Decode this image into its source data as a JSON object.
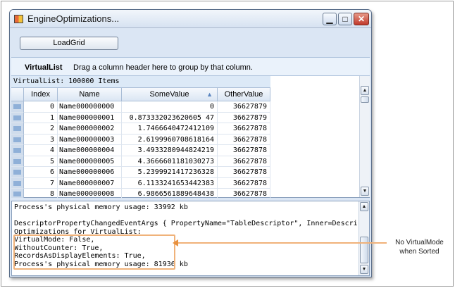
{
  "window": {
    "title": "EngineOptimizations...",
    "controls": {
      "minimize": "▁",
      "maximize": "□",
      "close": "✕"
    }
  },
  "toolbar": {
    "load_grid_label": "LoadGrid"
  },
  "group_bar": {
    "table_name": "VirtualList",
    "hint": "Drag a column header here to group by that column."
  },
  "grid": {
    "caption": "VirtualList: 100000 Items",
    "columns": [
      "Index",
      "Name",
      "SomeValue",
      "OtherValue"
    ],
    "sorted_column": "SomeValue",
    "sort_direction": "ascending",
    "rows": [
      {
        "index": "0",
        "name": "Name000000000",
        "some_value": "0",
        "other_value": "36627879"
      },
      {
        "index": "1",
        "name": "Name000000001",
        "some_value": "0.873332023620605 47",
        "other_value": "36627879"
      },
      {
        "index": "2",
        "name": "Name000000002",
        "some_value": "1.7466640472412109",
        "other_value": "36627878"
      },
      {
        "index": "3",
        "name": "Name000000003",
        "some_value": "2.6199960708618164",
        "other_value": "36627878"
      },
      {
        "index": "4",
        "name": "Name000000004",
        "some_value": "3.4933280944824219",
        "other_value": "36627878"
      },
      {
        "index": "5",
        "name": "Name000000005",
        "some_value": "4.3666601181030273",
        "other_value": "36627878"
      },
      {
        "index": "6",
        "name": "Name000000006",
        "some_value": "5.2399921417236328",
        "other_value": "36627878"
      },
      {
        "index": "7",
        "name": "Name000000007",
        "some_value": "6.1133241653442383",
        "other_value": "36627878"
      },
      {
        "index": "8",
        "name": "Name000000008",
        "some_value": "6.9866561889648438",
        "other_value": "36627878"
      }
    ]
  },
  "log": {
    "lines": [
      "Process's physical memory usage: 33992 kb",
      "",
      "DescriptorPropertyChangedEventArgs { PropertyName=\"TableDescriptor\", Inner=DescriptorProp",
      "Optimizations for VirtualList:",
      "VirtualMode: False,",
      "WithoutCounter: True,",
      "RecordsAsDisplayElements: True,",
      "Process's physical memory usage: 81936 kb"
    ]
  },
  "annotation": {
    "line1": "No VirtualMode",
    "line2": "when Sorted",
    "color": "#f0b27a"
  }
}
